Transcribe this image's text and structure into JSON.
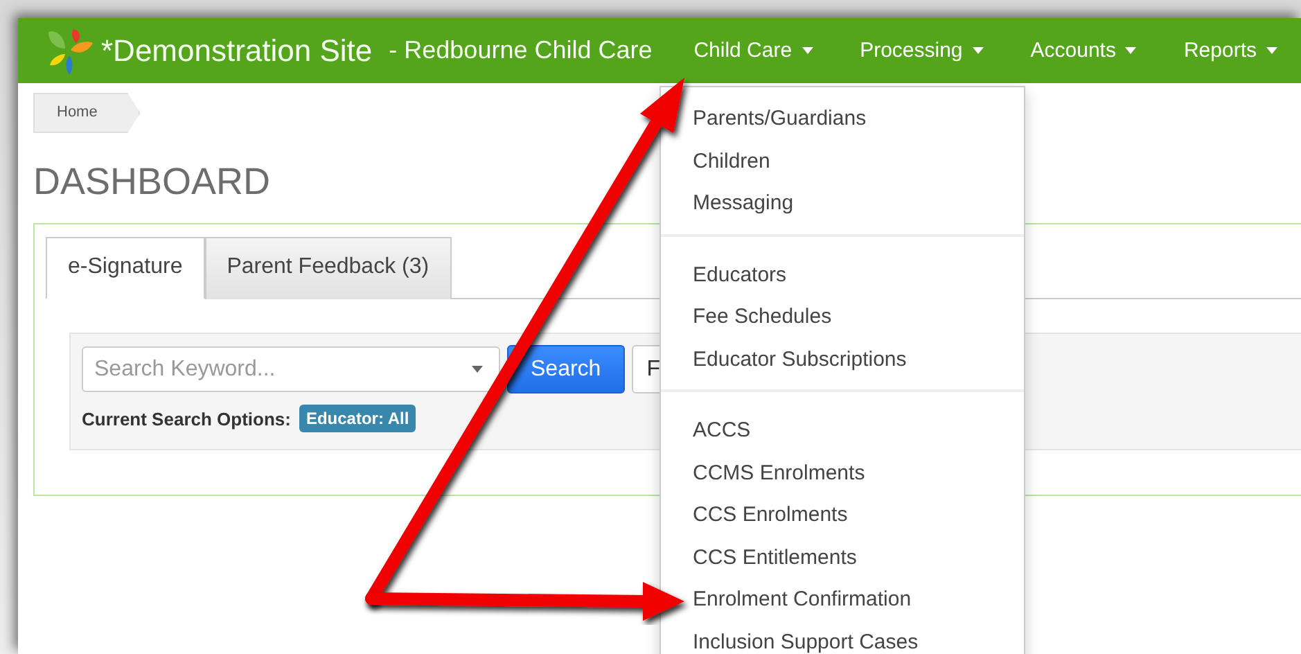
{
  "navbar": {
    "site_title": "*Demonstration Site",
    "site_subtitle": "- Redbourne Child Care",
    "menus": [
      {
        "label": "Child Care"
      },
      {
        "label": "Processing"
      },
      {
        "label": "Accounts"
      },
      {
        "label": "Reports"
      }
    ]
  },
  "breadcrumb": [
    "Home"
  ],
  "page_title": "DASHBOARD",
  "tabs": [
    {
      "label": "e-Signature",
      "selected": true
    },
    {
      "label": "Parent Feedback (3)",
      "selected": false
    }
  ],
  "search": {
    "placeholder": "Search Keyword...",
    "button": "Search",
    "second_button": "F",
    "options_label": "Current Search Options:",
    "option_badges": [
      "Educator: All"
    ]
  },
  "dropdown": {
    "sections": [
      [
        "Parents/Guardians",
        "Children",
        "Messaging"
      ],
      [
        "Educators",
        "Fee Schedules",
        "Educator Subscriptions"
      ],
      [
        "ACCS",
        "CCMS Enrolments",
        "CCS Enrolments",
        "CCS Entitlements",
        "Enrolment Confirmation",
        "Inclusion Support Cases"
      ]
    ]
  }
}
